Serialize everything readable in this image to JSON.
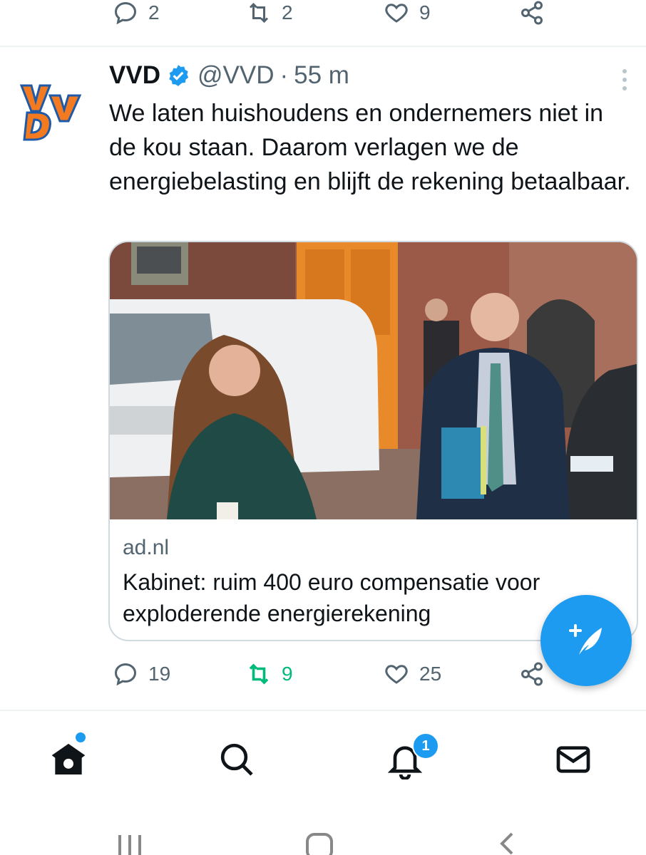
{
  "prev_tweet": {
    "actions": [
      {
        "icon": "reply-icon",
        "count": "2"
      },
      {
        "icon": "retweet-icon",
        "count": "2"
      },
      {
        "icon": "like-icon",
        "count": "9"
      },
      {
        "icon": "share-icon",
        "count": ""
      }
    ]
  },
  "tweet": {
    "display_name": "VVD",
    "verified": true,
    "handle": "@VVD",
    "separator": "·",
    "time": "55 m",
    "text": "We laten huishoudens en ondernemers niet in de kou staan. Daarom verlagen we de energiebelasting en blijft de rekening betaalbaar.",
    "card": {
      "domain": "ad.nl",
      "title": "Kabinet: ruim 400 euro compensatie voor exploderende energierekening"
    },
    "actions": {
      "replies": "19",
      "retweets": "9",
      "likes": "25"
    }
  },
  "nav": {
    "items": [
      "home-icon",
      "search-icon",
      "notifications-icon",
      "messages-icon"
    ],
    "notification_badge": "1"
  },
  "colors": {
    "accent": "#1d9bf0",
    "retweet_active": "#00ba7c",
    "muted": "#536471",
    "brand_orange": "#f47a20",
    "brand_blue": "#1e5aa8"
  }
}
